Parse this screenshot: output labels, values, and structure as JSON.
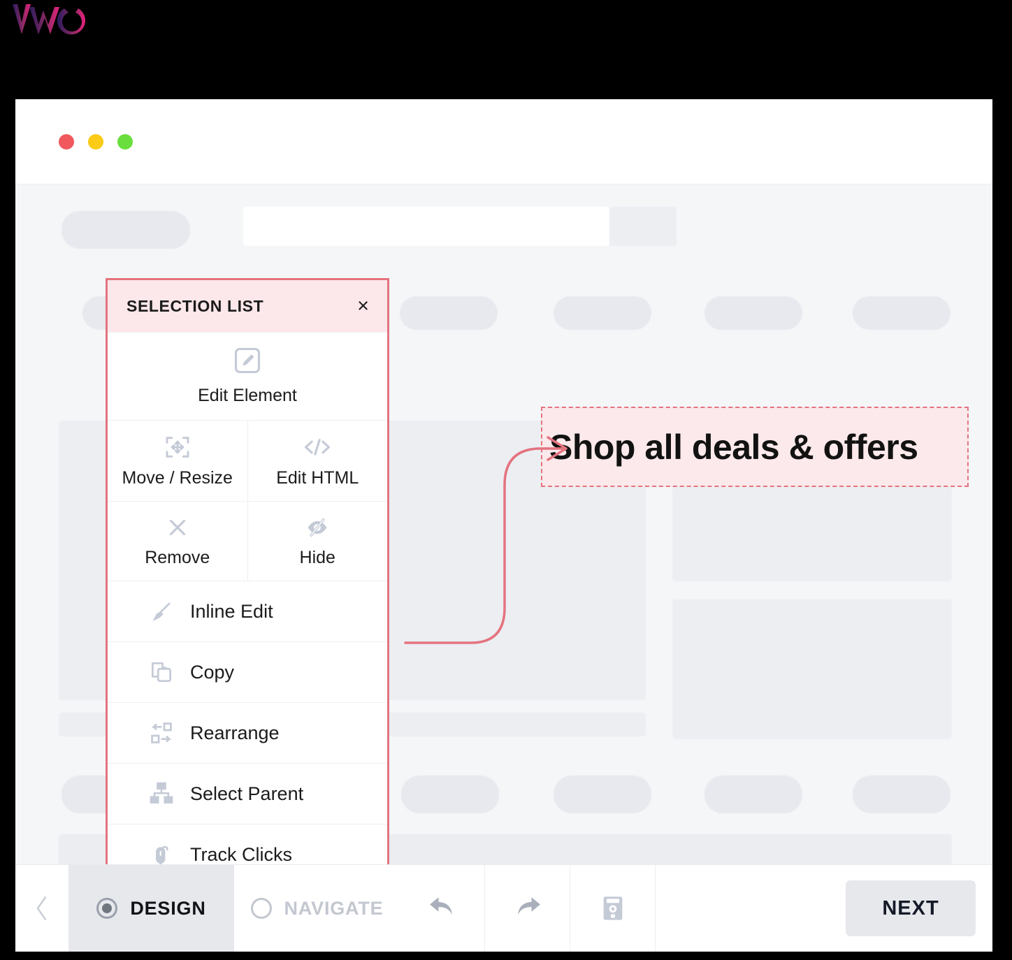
{
  "brand": {
    "logo_text": "VWO",
    "gradient_start": "#2B1A5E",
    "gradient_end": "#E5227B"
  },
  "browser": {
    "dots": [
      {
        "name": "close",
        "color": "#F0585E"
      },
      {
        "name": "minimize",
        "color": "#FBCB15"
      },
      {
        "name": "maximize",
        "color": "#69DE3C"
      }
    ]
  },
  "target": {
    "text": "Shop all deals & offers",
    "border_color": "#E4737F",
    "fill_color": "#FCE9EB"
  },
  "panel": {
    "title": "SELECTION LIST",
    "close_label": "×",
    "border_color": "#E4737F",
    "header_color": "#FCE7EA",
    "primary": {
      "label": "Edit Element",
      "icon": "edit-element-icon"
    },
    "pairs": [
      [
        {
          "label": "Move / Resize",
          "icon": "move-resize-icon"
        },
        {
          "label": "Edit HTML",
          "icon": "code-icon"
        }
      ],
      [
        {
          "label": "Remove",
          "icon": "close-x-icon"
        },
        {
          "label": "Hide",
          "icon": "eye-slash-icon"
        }
      ]
    ],
    "items": [
      {
        "label": "Inline Edit",
        "icon": "brush-icon"
      },
      {
        "label": "Copy",
        "icon": "copy-icon"
      },
      {
        "label": "Rearrange",
        "icon": "rearrange-icon"
      },
      {
        "label": "Select Parent",
        "icon": "sitemap-icon"
      },
      {
        "label": "Track Clicks",
        "icon": "mouse-icon"
      }
    ]
  },
  "footer": {
    "back_icon": "chevron-left-icon",
    "modes": [
      {
        "label": "DESIGN",
        "selected": true
      },
      {
        "label": "NAVIGATE",
        "selected": false
      }
    ],
    "tools": [
      {
        "name": "undo-icon"
      },
      {
        "name": "redo-icon"
      },
      {
        "name": "save-icon"
      }
    ],
    "next_label": "NEXT"
  }
}
